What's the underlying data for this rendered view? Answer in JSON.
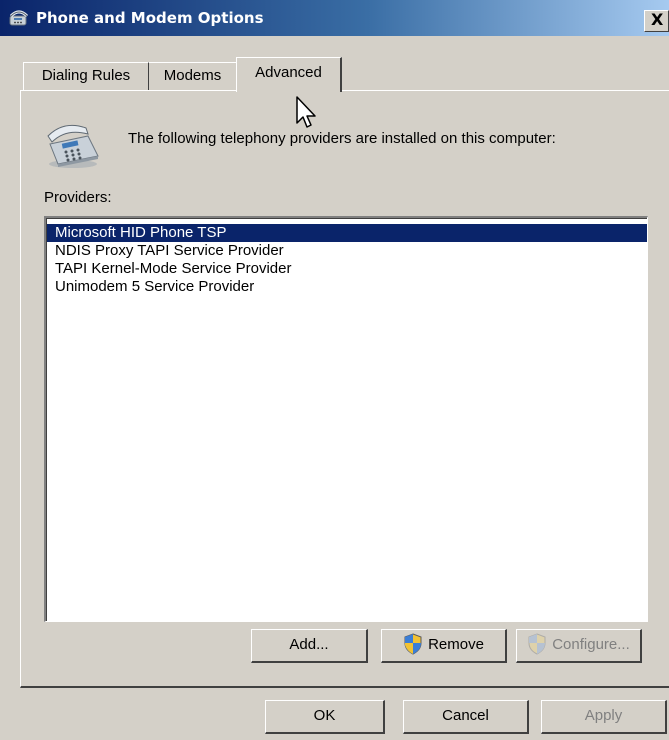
{
  "window": {
    "title": "Phone and Modem Options",
    "close_label": "X",
    "title_icon": "phone-modem-icon"
  },
  "colors": {
    "titlebar_start": "#0a246a",
    "titlebar_end": "#a6caf0",
    "face": "#d4d0c8",
    "selection": "#0a246a"
  },
  "tabs": [
    {
      "label": "Dialing Rules",
      "selected": false
    },
    {
      "label": "Modems",
      "selected": false
    },
    {
      "label": "Advanced",
      "selected": true
    }
  ],
  "advanced": {
    "icon": "telephone-icon",
    "intro": "The following telephony providers are installed on this computer:",
    "providers_label": "Providers:",
    "providers": [
      {
        "name": "Microsoft HID Phone TSP",
        "selected": true
      },
      {
        "name": "NDIS Proxy TAPI Service Provider",
        "selected": false
      },
      {
        "name": "TAPI Kernel-Mode Service Provider",
        "selected": false
      },
      {
        "name": "Unimodem 5 Service Provider",
        "selected": false
      }
    ],
    "buttons": {
      "add": "Add...",
      "remove": "Remove",
      "configure": "Configure..."
    }
  },
  "dialog_buttons": {
    "ok": "OK",
    "cancel": "Cancel",
    "apply": "Apply"
  }
}
